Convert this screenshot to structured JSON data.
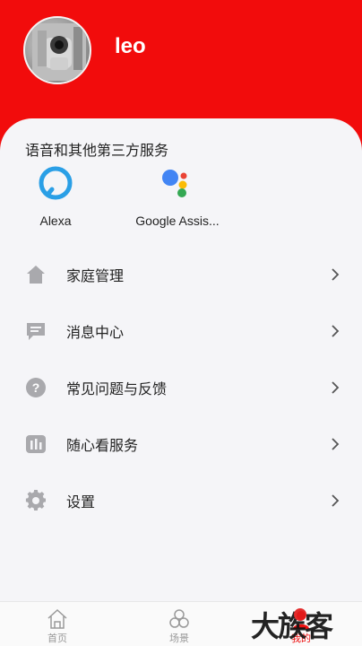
{
  "profile": {
    "username": "leo"
  },
  "services": {
    "title": "语音和其他第三方服务",
    "items": [
      {
        "label": "Alexa",
        "icon": "alexa-icon"
      },
      {
        "label": "Google Assis...",
        "icon": "google-assistant-icon"
      }
    ]
  },
  "menu": {
    "items": [
      {
        "label": "家庭管理",
        "icon": "home-icon"
      },
      {
        "label": "消息中心",
        "icon": "message-icon"
      },
      {
        "label": "常见问题与反馈",
        "icon": "help-icon"
      },
      {
        "label": "随心看服务",
        "icon": "chart-icon"
      },
      {
        "label": "设置",
        "icon": "gear-icon"
      }
    ]
  },
  "tabbar": {
    "items": [
      {
        "label": "首页",
        "icon": "home-tab-icon"
      },
      {
        "label": "场景",
        "icon": "scene-tab-icon"
      },
      {
        "label": "我的",
        "icon": "profile-tab-icon"
      }
    ]
  },
  "watermark": {
    "text": "大族客"
  },
  "colors": {
    "brand_red": "#f20c0c",
    "menu_icon_gray": "#a9a9ad",
    "google_blue": "#4285f4",
    "google_red": "#ea4335",
    "google_yellow": "#fbbc05",
    "google_green": "#34a853",
    "alexa_blue": "#2a9fe6"
  }
}
